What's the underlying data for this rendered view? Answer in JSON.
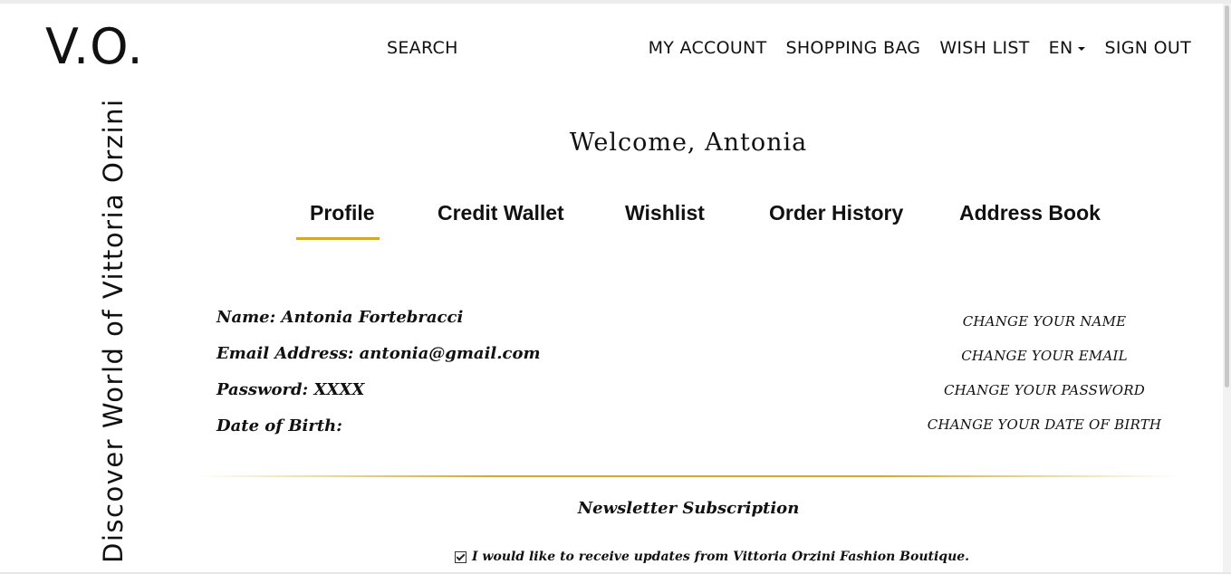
{
  "header": {
    "logo": "V.O.",
    "search": "SEARCH",
    "nav": {
      "my_account": "MY ACCOUNT",
      "shopping_bag": "SHOPPING BAG",
      "wish_list": "WISH LIST",
      "language": "EN",
      "sign_out": "SIGN OUT"
    }
  },
  "sidebar": {
    "tagline": "Discover World of Vittoria Orzini"
  },
  "welcome": "Welcome, Antonia",
  "tabs": [
    "Profile",
    "Credit Wallet",
    "Wishlist",
    "Order History",
    "Address Book"
  ],
  "active_tab": "Profile",
  "profile": {
    "name": "Name: Antonia Fortebracci",
    "email": "Email Address: antonia@gmail.com",
    "password": "Password: XXXX",
    "dob": "Date of Birth:"
  },
  "actions": {
    "change_name": "CHANGE YOUR NAME",
    "change_email": "CHANGE YOUR EMAIL",
    "change_password": "CHANGE YOUR PASSWORD",
    "change_dob": "CHANGE YOUR DATE OF BIRTH"
  },
  "newsletter": {
    "title": "Newsletter Subscription",
    "checkbox_label": "I would like to receive updates from Vittoria Orzini Fashion Boutique.",
    "checked": true
  },
  "colors": {
    "accent": "#d4a92a",
    "text": "#111111",
    "background": "#ffffff"
  }
}
